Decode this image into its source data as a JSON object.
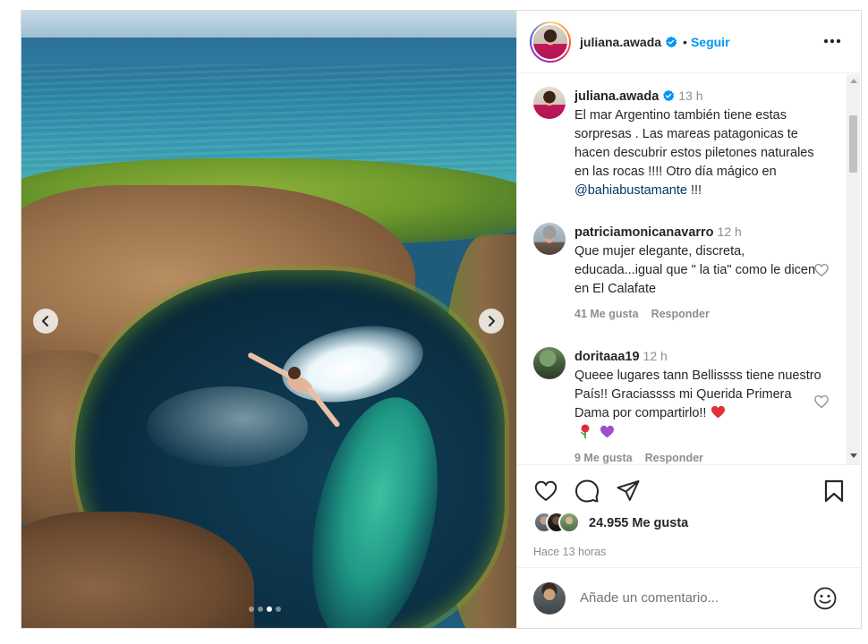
{
  "colors": {
    "accent": "#0095f6",
    "link": "#00376b",
    "muted": "#8e8e8e",
    "text": "#262626",
    "verified": "#0095f6",
    "heart_red": "#ed4956"
  },
  "media": {
    "carousel": {
      "dot_count": 4,
      "active_index": 2
    },
    "prev_icon": "chevron-left-icon",
    "next_icon": "chevron-right-icon"
  },
  "header": {
    "username": "juliana.awada",
    "verified_icon": "verified-badge-icon",
    "separator": "•",
    "follow_label": "Seguir",
    "more_icon": "more-horizontal-icon"
  },
  "caption": {
    "username": "juliana.awada",
    "time": "13 h",
    "text": "El mar Argentino también tiene estas sorpresas . Las mareas patagonicas te hacen descubrir estos piletones naturales en las rocas !!!! Otro día mágico en ",
    "mention": "@bahiabustamante",
    "text_end": " !!!"
  },
  "comments": [
    {
      "username": "patriciamonicanavarro",
      "time": "12 h",
      "text": "Que mujer elegante, discreta, educada...igual que \" la tia\" como le dicen en El Calafate",
      "likes": "41 Me gusta",
      "reply": "Responder"
    },
    {
      "username": "doritaaa19",
      "time": "12 h",
      "text": "Queee lugares tann Bellissss tiene nuestro País!! Graciassss mi Querida Primera Dama por compartirlo!! ",
      "emoji": [
        "red-heart-emoji",
        "rose-emoji",
        "purple-heart-emoji"
      ],
      "likes": "9 Me gusta",
      "reply": "Responder"
    }
  ],
  "actions": {
    "icons": [
      "heart-icon",
      "comment-icon",
      "share-icon",
      "bookmark-icon"
    ],
    "likes_count": "24.955 Me gusta",
    "time_ago": "Hace 13 horas"
  },
  "add_comment": {
    "placeholder": "Añade un comentario...",
    "emoji_icon": "smiley-icon"
  }
}
